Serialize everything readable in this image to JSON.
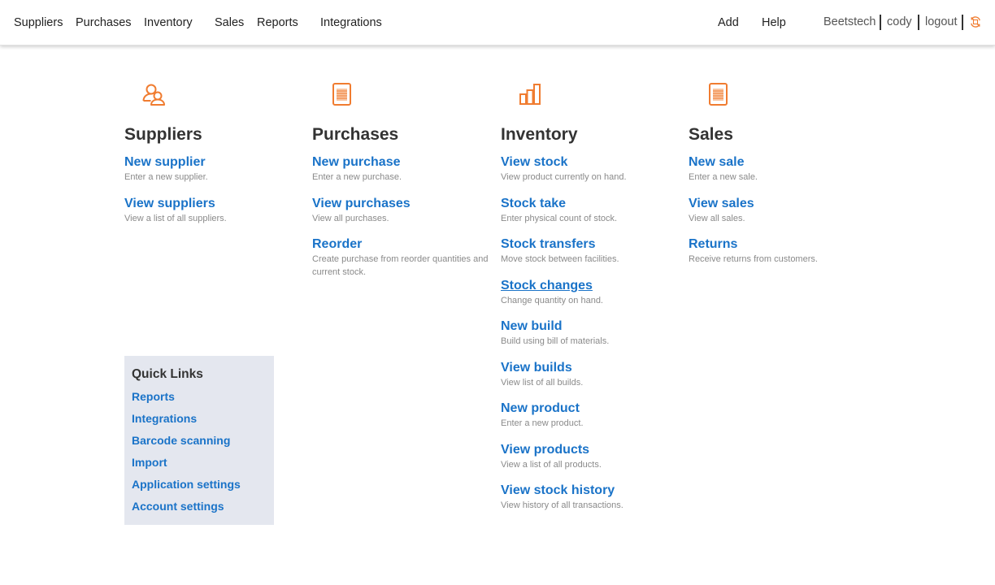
{
  "nav": {
    "left": [
      "Suppliers",
      "Purchases",
      "Inventory",
      "Sales",
      "Reports",
      "Integrations"
    ],
    "add": "Add",
    "help": "Help",
    "company": "Beetstech",
    "user": "cody",
    "logout": "logout"
  },
  "colors": {
    "accent": "#f07c30",
    "link": "#1a73c8",
    "quick_bg": "#e4e7ef"
  },
  "sections": [
    {
      "icon": "users-icon",
      "title": "Suppliers",
      "items": [
        {
          "label": "New supplier",
          "desc": "Enter a new supplier."
        },
        {
          "label": "View suppliers",
          "desc": "View a list of all suppliers."
        }
      ]
    },
    {
      "icon": "document-icon",
      "title": "Purchases",
      "items": [
        {
          "label": "New purchase",
          "desc": "Enter a new purchase."
        },
        {
          "label": "View purchases",
          "desc": "View all purchases."
        },
        {
          "label": "Reorder",
          "desc": "Create purchase from reorder quantities and current stock."
        }
      ]
    },
    {
      "icon": "bar-chart-icon",
      "title": "Inventory",
      "items": [
        {
          "label": "View stock",
          "desc": "View product currently on hand."
        },
        {
          "label": "Stock take",
          "desc": "Enter physical count of stock."
        },
        {
          "label": "Stock transfers",
          "desc": "Move stock between facilities."
        },
        {
          "label": "Stock changes",
          "desc": "Change quantity on hand."
        },
        {
          "label": "New build",
          "desc": "Build using bill of materials."
        },
        {
          "label": "View builds",
          "desc": "View list of all builds."
        },
        {
          "label": "New product",
          "desc": "Enter a new product."
        },
        {
          "label": "View products",
          "desc": "View a list of all products."
        },
        {
          "label": "View stock history",
          "desc": "View history of all transactions."
        }
      ]
    },
    {
      "icon": "document-icon",
      "title": "Sales",
      "items": [
        {
          "label": "New sale",
          "desc": "Enter a new sale."
        },
        {
          "label": "View sales",
          "desc": "View all sales."
        },
        {
          "label": "Returns",
          "desc": "Receive returns from customers."
        }
      ]
    }
  ],
  "quick_links": {
    "title": "Quick Links",
    "items": [
      "Reports",
      "Integrations",
      "Barcode scanning",
      "Import",
      "Application settings",
      "Account settings"
    ]
  }
}
